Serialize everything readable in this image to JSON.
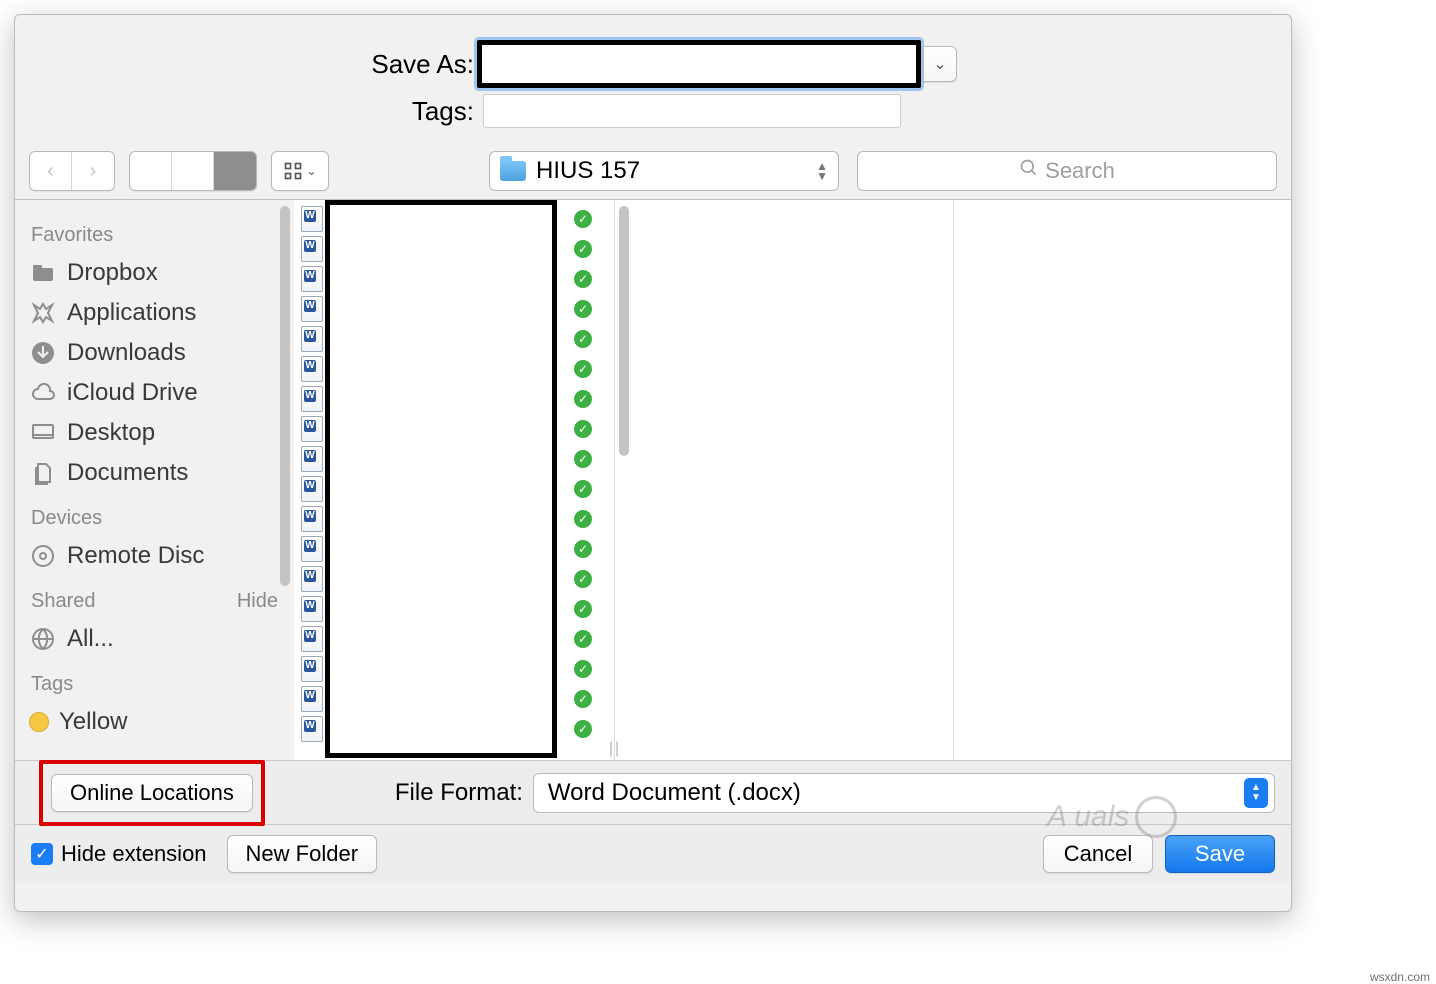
{
  "form": {
    "save_as_label": "Save As:",
    "tags_label": "Tags:",
    "filename_value": "",
    "tags_value": ""
  },
  "toolbar": {
    "path": "HIUS 157",
    "search_placeholder": "Search"
  },
  "sidebar": {
    "favorites_header": "Favorites",
    "favorites": [
      {
        "label": "Dropbox"
      },
      {
        "label": "Applications"
      },
      {
        "label": "Downloads"
      },
      {
        "label": "iCloud Drive"
      },
      {
        "label": "Desktop"
      },
      {
        "label": "Documents"
      }
    ],
    "devices_header": "Devices",
    "devices": [
      {
        "label": "Remote Disc"
      }
    ],
    "shared_header": "Shared",
    "shared_hide": "Hide",
    "shared": [
      {
        "label": "All..."
      }
    ],
    "tags_header": "Tags",
    "tags": [
      {
        "label": "Yellow"
      }
    ]
  },
  "midbar": {
    "online_locations_label": "Online Locations",
    "file_format_label": "File Format:",
    "file_format_value": "Word Document (.docx)"
  },
  "bottombar": {
    "hide_extension_label": "Hide extension",
    "hide_extension_checked": true,
    "new_folder_label": "New Folder",
    "cancel_label": "Cancel",
    "save_label": "Save"
  },
  "watermark": {
    "text": "A  uals",
    "site": "wsxdn.com"
  }
}
